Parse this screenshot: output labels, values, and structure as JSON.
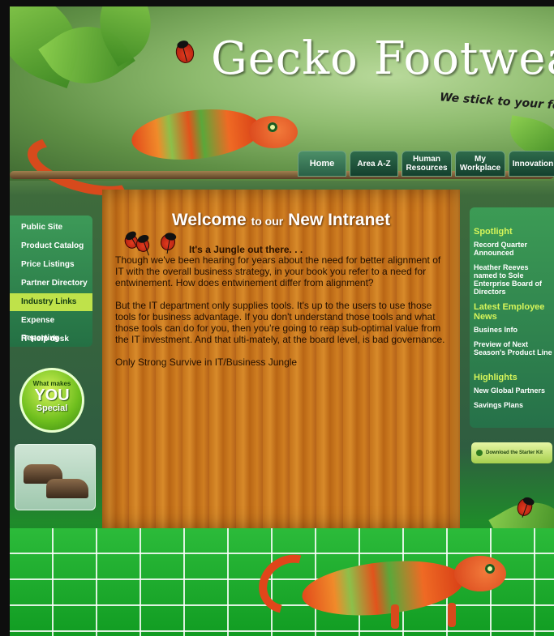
{
  "header": {
    "logo_text": "Gecko Footwear",
    "tagline": "We stick to your feet"
  },
  "nav": {
    "tabs": [
      {
        "label": "Home"
      },
      {
        "label": "Area A-Z"
      },
      {
        "label": "Human Resources"
      },
      {
        "label": "My Workplace"
      },
      {
        "label": "Innovation"
      }
    ]
  },
  "left_nav": {
    "items": [
      {
        "label": "Public Site"
      },
      {
        "label": "Product Catalog"
      },
      {
        "label": "Price Listings"
      },
      {
        "label": "Partner Directory"
      },
      {
        "label": "Industry Links"
      },
      {
        "label": "Expense Reporting"
      },
      {
        "label": "IT Help desk"
      }
    ],
    "active_index": 4
  },
  "promo": {
    "line1": "What makes",
    "line2": "YOU",
    "line3": "Special"
  },
  "main": {
    "welcome_prefix": "Welcome",
    "welcome_mid": "to our",
    "welcome_suffix": "New Intranet",
    "subhead": "It's a Jungle out there. . .",
    "paragraphs": [
      "Though we've been hearing for years about the need for better alignment of IT with the overall business strategy, in your book you refer to a need for entwinement. How does entwinement differ from alignment?",
      "But the IT department only supplies tools. It's up to the users to use those tools for business advantage. If you don't understand those tools and what those tools can do for you, then you're going to reap sub-optimal value from the IT investment. And that ulti-mately, at the board level, is bad governance.",
      "Only Strong Survive in IT/Business Jungle"
    ]
  },
  "right_sidebar": {
    "spotlight_heading": "Spotlight",
    "spotlight_items": [
      "Record Quarter Announced",
      "Heather Reeves named to Sole Enterprise Board of Directors"
    ],
    "news_heading": "Latest Employee News",
    "news_items": [
      "Busines Info",
      "Preview of Next Season's Product Line"
    ],
    "highlights_heading": "Highlights",
    "highlights_items": [
      "New Global Partners",
      "Savings Plans"
    ],
    "download_label": "Download the Starter Kit"
  },
  "colors": {
    "accent_yellow_green": "#bfe24a",
    "sidebar_green": "#2f8a4e",
    "wood": "#c8761d",
    "heading_text_dark": "#2a1200"
  }
}
